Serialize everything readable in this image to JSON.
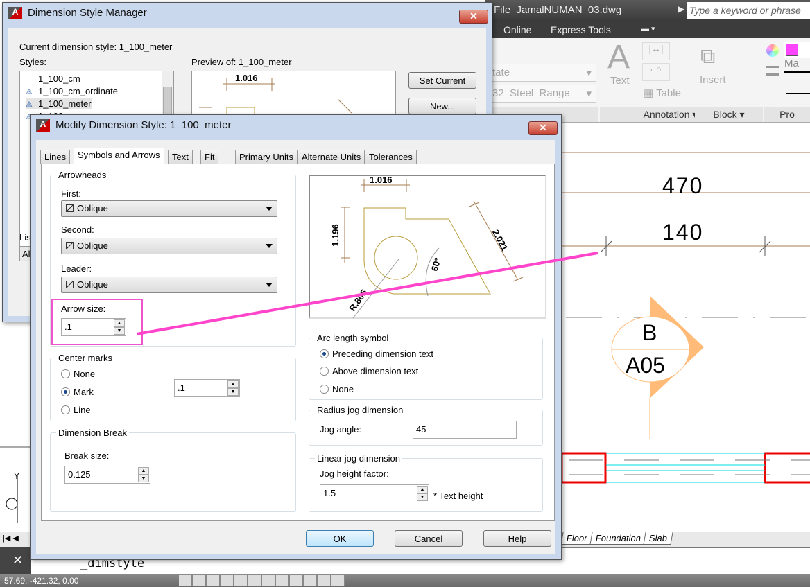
{
  "app": {
    "file_title": "File_JamalNUMAN_03.dwg",
    "search_placeholder": "Type a keyword or phrase",
    "menu": [
      "Online",
      "Express Tools"
    ],
    "ribbon": {
      "layer_combo_1": "tate",
      "layer_combo_2": "32_Steel_Range",
      "text_label": "Text",
      "table_label": "Table",
      "insert_label": "Insert",
      "color_label": "Ma",
      "color_swatch": "#ff44ff",
      "panels": [
        "Annotation",
        "Block",
        "Pro"
      ]
    },
    "drawing": {
      "dim_470": "470",
      "dim_140": "140",
      "section_top": "B",
      "section_bottom": "A05",
      "annotation_line_color": "#ff44cc",
      "section_color": "#ffbb77",
      "wall_color": "#ee0000",
      "beam_color": "#00dddd"
    },
    "layout_tabs": [
      "Floor",
      "Foundation",
      "Slab"
    ],
    "command_text": "_dimstyle",
    "coordinates": "57.69, -421.32, 0.00"
  },
  "style_manager": {
    "title": "Dimension Style Manager",
    "current_style_label": "Current dimension style: 1_100_meter",
    "styles_label": "Styles:",
    "styles": [
      "1_100_cm",
      "1_100_cm_ordinate",
      "1_100_meter",
      "1_100..."
    ],
    "selected_style": "1_100_meter",
    "preview_label": "Preview of: 1_100_meter",
    "preview_dim": "1.016",
    "list_label": "Lis",
    "list_value": "Al",
    "set_current_button": "Set Current",
    "new_button": "New..."
  },
  "modify_dialog": {
    "title": "Modify Dimension Style: 1_100_meter",
    "tabs": [
      "Lines",
      "Symbols and Arrows",
      "Text",
      "Fit",
      "Primary Units",
      "Alternate Units",
      "Tolerances"
    ],
    "active_tab": "Symbols and Arrows",
    "arrowheads": {
      "group_label": "Arrowheads",
      "first_label": "First:",
      "first_value": "Oblique",
      "second_label": "Second:",
      "second_value": "Oblique",
      "leader_label": "Leader:",
      "leader_value": "Oblique",
      "arrow_size_label": "Arrow size:",
      "arrow_size_value": ".1",
      "highlight_color": "#ee55cc"
    },
    "center_marks": {
      "group_label": "Center marks",
      "options": [
        "None",
        "Mark",
        "Line"
      ],
      "selected": "Mark",
      "size_value": ".1"
    },
    "dimension_break": {
      "group_label": "Dimension Break",
      "break_size_label": "Break size:",
      "break_size_value": "0.125"
    },
    "preview": {
      "dim_top": "1.016",
      "dim_left": "1.196",
      "dim_diag": "2.021",
      "dim_angle": "60°",
      "dim_radius": "R.805"
    },
    "arc_length": {
      "group_label": "Arc length symbol",
      "options": [
        "Preceding dimension text",
        "Above dimension text",
        "None"
      ],
      "selected": "Preceding dimension text"
    },
    "radius_jog": {
      "group_label": "Radius jog dimension",
      "jog_angle_label": "Jog angle:",
      "jog_angle_value": "45"
    },
    "linear_jog": {
      "group_label": "Linear jog dimension",
      "jog_height_label": "Jog height factor:",
      "jog_height_value": "1.5",
      "jog_height_suffix": "* Text height"
    },
    "ok_button": "OK",
    "cancel_button": "Cancel",
    "help_button": "Help"
  }
}
